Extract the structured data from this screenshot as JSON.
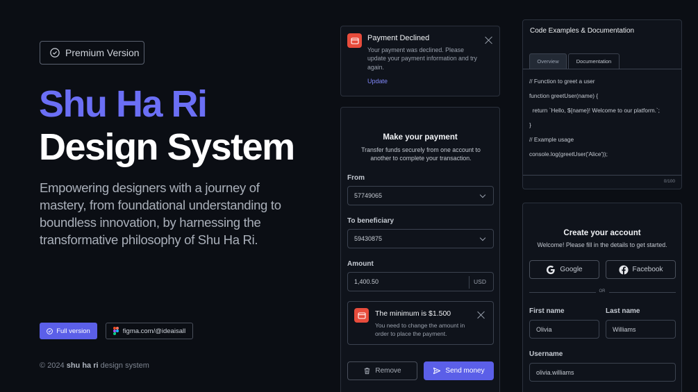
{
  "hero": {
    "badge": "Premium Version",
    "title_accent": "Shu Ha Ri",
    "title_main": "Design System",
    "lead": "Empowering designers with a journey of mastery, from foundational understanding to boundless innovation, by harnessing the transformative philosophy of Shu Ha Ri.",
    "btn_full": "Full version",
    "btn_figma": "figma.com/@ideaisall",
    "footer_prefix": "© 2024",
    "footer_bold": "shu ha ri",
    "footer_suffix": "design system"
  },
  "alert": {
    "title": "Payment Declined",
    "message": "Your payment was declined. Please update your payment information and try again.",
    "action": "Update"
  },
  "payment": {
    "title": "Make your payment",
    "subtitle": "Transfer funds securely from one account to another to complete your transaction.",
    "from_label": "From",
    "from_value": "57749065",
    "to_label": "To beneficiary",
    "to_value": "59430875",
    "amount_label": "Amount",
    "amount_value": "1,400.50",
    "currency": "USD",
    "warn_title": "The minimum is $1.500",
    "warn_msg": "You need to change the amount in order to place the payment.",
    "remove": "Remove",
    "send": "Send money"
  },
  "code": {
    "title": "Code Examples & Documentation",
    "tabs": [
      "Overview",
      "Documentation"
    ],
    "lines": [
      "// Function to greet a user",
      "function greetUser(name) {",
      "  return `Hello, ${name}! Welcome to our platform.`;",
      "}",
      "// Example usage",
      "console.log(greetUser('Alice'));"
    ],
    "counter": "0/100"
  },
  "account": {
    "title": "Create your account",
    "subtitle": "Welcome! Please fill in the details to get started.",
    "google": "Google",
    "facebook": "Facebook",
    "or": "OR",
    "first_label": "First name",
    "first_value": "Olivia",
    "last_label": "Last name",
    "last_value": "Williams",
    "user_label": "Username",
    "user_value": "olivia.williams"
  },
  "colors": {
    "accent": "#6b6ff5",
    "danger": "#e74c3c",
    "bg": "#0b0e14"
  }
}
